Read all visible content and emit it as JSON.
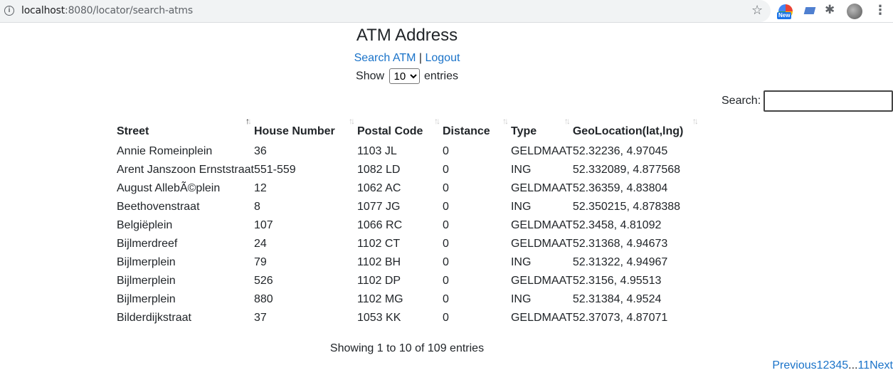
{
  "browser": {
    "url_host": "localhost",
    "url_rest": ":8080/locator/search-atms",
    "ext_badge": "New"
  },
  "page": {
    "title": "ATM Address",
    "nav": {
      "search": "Search ATM",
      "separator": "|",
      "logout": "Logout"
    },
    "length": {
      "show": "Show",
      "entries": "entries",
      "selected": "10"
    },
    "search_label": "Search:",
    "search_value": ""
  },
  "table": {
    "columns": [
      "Street",
      "House Number",
      "Postal Code",
      "Distance",
      "Type",
      "GeoLocation(lat,lng)"
    ],
    "rows": [
      [
        "Annie Romeinplein",
        "36",
        "1103 JL",
        "0",
        "GELDMAAT",
        "52.32236, 4.97045"
      ],
      [
        "Arent Janszoon Ernststraat",
        "551-559",
        "1082 LD",
        "0",
        "ING",
        "52.332089, 4.877568"
      ],
      [
        "August AllebÃ©plein",
        "12",
        "1062 AC",
        "0",
        "GELDMAAT",
        "52.36359, 4.83804"
      ],
      [
        "Beethovenstraat",
        "8",
        "1077 JG",
        "0",
        "ING",
        "52.350215, 4.878388"
      ],
      [
        "Belgiëplein",
        "107",
        "1066 RC",
        "0",
        "GELDMAAT",
        "52.3458, 4.81092"
      ],
      [
        "Bijlmerdreef",
        "24",
        "1102 CT",
        "0",
        "GELDMAAT",
        "52.31368, 4.94673"
      ],
      [
        "Bijlmerplein",
        "79",
        "1102 BH",
        "0",
        "ING",
        "52.31322, 4.94967"
      ],
      [
        "Bijlmerplein",
        "526",
        "1102 DP",
        "0",
        "GELDMAAT",
        "52.3156, 4.95513"
      ],
      [
        "Bijlmerplein",
        "880",
        "1102 MG",
        "0",
        "ING",
        "52.31384, 4.9524"
      ],
      [
        "Bilderdijkstraat",
        "37",
        "1053 KK",
        "0",
        "GELDMAAT",
        "52.37073, 4.87071"
      ]
    ]
  },
  "footer": {
    "info": "Showing 1 to 10 of 109 entries",
    "pagination": {
      "previous": "Previous",
      "pages": [
        "1",
        "2",
        "3",
        "4",
        "5"
      ],
      "ellipsis": "...",
      "last": "11",
      "next": "Next"
    }
  }
}
